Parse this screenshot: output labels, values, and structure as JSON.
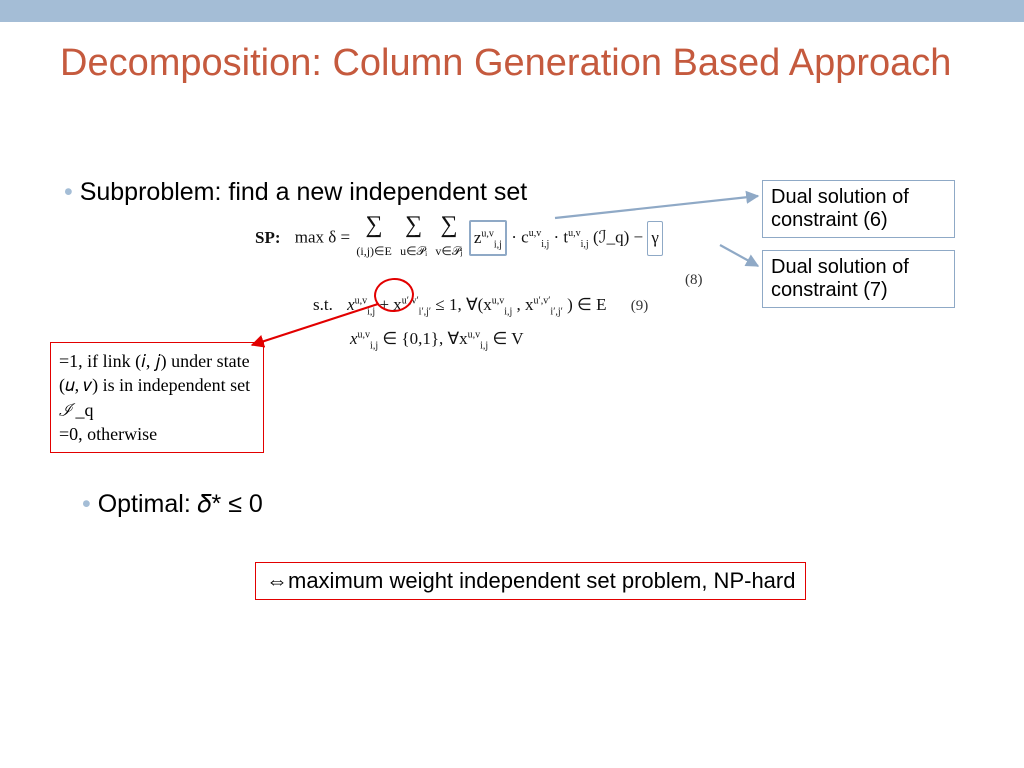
{
  "title": "Decomposition: Column Generation Based Approach",
  "bullet_subproblem": "Subproblem: find a new independent set",
  "bullet_optimal": "Optimal: 𝛿* ≤ 0",
  "sp": {
    "label": "SP:",
    "objective_prefix": "max  δ =",
    "sum1_under": "(i,j)∈E",
    "sum2_under": "u∈𝒫ᵢ",
    "sum3_under": "v∈𝒫ⱼ",
    "z_term": "z",
    "z_sub": "i,j",
    "z_sup": "u,v",
    "rest_obj": "· c",
    "c_sub": "i,j",
    "c_sup": "u,v",
    "t_part": "· t",
    "t_sub": "i,j",
    "t_sup": "u,v",
    "iq": "(ℐ_q) −",
    "gamma": "γ",
    "eq8": "(8)",
    "st_label": "s.t.",
    "constraint1_a": "x",
    "constraint1_sub": "i,j",
    "constraint1_sup": "u,v",
    "constraint1_b": "+ x",
    "constraint1_sub2": "i′,j′",
    "constraint1_sup2": "u′,v′",
    "constraint1_c": "≤ 1,  ∀(x",
    "constraint1_d": ", x",
    "constraint1_e": ") ∈ E",
    "eq9": "(9)",
    "constraint2": "x",
    "constraint2_rest": "∈ {0,1},  ∀x",
    "constraint2_tail": "∈ V"
  },
  "callout_left": "=1, if link (𝑖, 𝑗) under state (𝑢, 𝑣) is in independent set ℐ_q\n=0, otherwise",
  "callout_r1": "Dual solution of constraint (6)",
  "callout_r2": "Dual solution of constraint (7)",
  "callout_bottom": "⇔maximum weight independent set problem, NP-hard"
}
